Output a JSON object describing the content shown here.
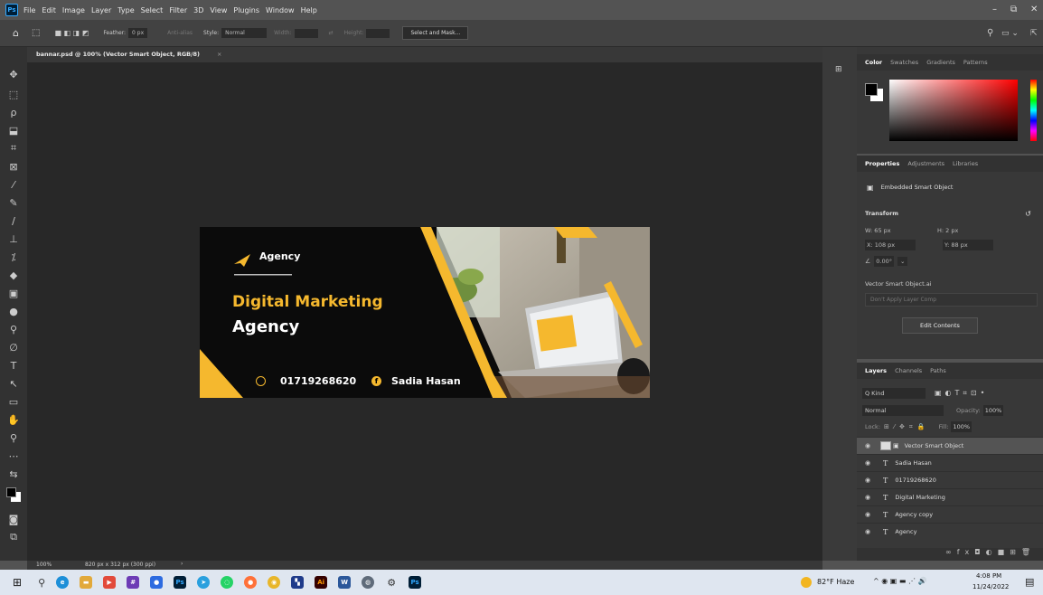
{
  "menubar": {
    "items": [
      "File",
      "Edit",
      "Image",
      "Layer",
      "Type",
      "Select",
      "Filter",
      "3D",
      "View",
      "Plugins",
      "Window",
      "Help"
    ]
  },
  "options": {
    "feather_label": "Feather:",
    "feather_value": "0 px",
    "antialias": "Anti-alias",
    "style_label": "Style:",
    "style_value": "Normal",
    "width_label": "Width:",
    "height_label": "Height:",
    "select_mask": "Select and Mask..."
  },
  "document": {
    "tab_title": "bannar.psd @ 100% (Vector Smart Object, RGB/8)",
    "zoom": "100%",
    "size_info": "820 px x 312 px (300 ppi)"
  },
  "banner": {
    "brand": "Agency",
    "headline1": "Digital Marketing",
    "headline2": "Agency",
    "phone": "01719268620",
    "name": "Sadia Hasan",
    "accent": "#f5b82e"
  },
  "color_panel": {
    "tabs": [
      "Color",
      "Swatches",
      "Gradients",
      "Patterns"
    ]
  },
  "properties": {
    "tabs": [
      "Properties",
      "Adjustments",
      "Libraries"
    ],
    "type": "Embedded Smart Object",
    "transform": "Transform",
    "w": "W: 65 px",
    "h": "H: 2 px",
    "x": "X: 108 px",
    "y": "Y: 88 px",
    "angle": "0.00°",
    "file": "Vector Smart Object.ai",
    "layer_comp": "Don't Apply Layer Comp",
    "edit_btn": "Edit Contents"
  },
  "layers": {
    "tabs": [
      "Layers",
      "Channels",
      "Paths"
    ],
    "kind": "Q Kind",
    "blend": "Normal",
    "opacity_label": "Opacity:",
    "opacity": "100%",
    "lock_label": "Lock:",
    "fill_label": "Fill:",
    "fill": "100%",
    "items": [
      {
        "name": "Vector Smart Object",
        "type": "smart"
      },
      {
        "name": "Sadia Hasan",
        "type": "text"
      },
      {
        "name": "01719268620",
        "type": "text"
      },
      {
        "name": "Digital Marketing",
        "type": "text"
      },
      {
        "name": "Agency copy",
        "type": "text"
      },
      {
        "name": "Agency",
        "type": "text"
      }
    ]
  },
  "taskbar": {
    "weather": "82°F Haze",
    "time": "4:08 PM",
    "date": "11/24/2022"
  }
}
